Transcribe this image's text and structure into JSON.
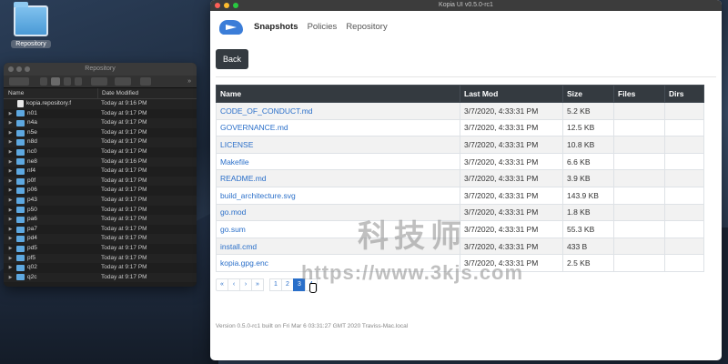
{
  "desktop": {
    "icon_label": "Repository"
  },
  "finder": {
    "title": "Repository",
    "columns": {
      "name": "Name",
      "date": "Date Modified"
    },
    "rows": [
      {
        "name": "kopia.repository.f",
        "date": "Today at 9:16 PM",
        "kind": "file"
      },
      {
        "name": "n01",
        "date": "Today at 9:17 PM",
        "kind": "folder"
      },
      {
        "name": "n4a",
        "date": "Today at 9:17 PM",
        "kind": "folder"
      },
      {
        "name": "n5e",
        "date": "Today at 9:17 PM",
        "kind": "folder"
      },
      {
        "name": "n8d",
        "date": "Today at 9:17 PM",
        "kind": "folder"
      },
      {
        "name": "nc0",
        "date": "Today at 9:17 PM",
        "kind": "folder"
      },
      {
        "name": "ne8",
        "date": "Today at 9:16 PM",
        "kind": "folder"
      },
      {
        "name": "nf4",
        "date": "Today at 9:17 PM",
        "kind": "folder"
      },
      {
        "name": "p0f",
        "date": "Today at 9:17 PM",
        "kind": "folder"
      },
      {
        "name": "p06",
        "date": "Today at 9:17 PM",
        "kind": "folder"
      },
      {
        "name": "p43",
        "date": "Today at 9:17 PM",
        "kind": "folder"
      },
      {
        "name": "p50",
        "date": "Today at 9:17 PM",
        "kind": "folder"
      },
      {
        "name": "pa6",
        "date": "Today at 9:17 PM",
        "kind": "folder"
      },
      {
        "name": "pa7",
        "date": "Today at 9:17 PM",
        "kind": "folder"
      },
      {
        "name": "pd4",
        "date": "Today at 9:17 PM",
        "kind": "folder"
      },
      {
        "name": "pd5",
        "date": "Today at 9:17 PM",
        "kind": "folder"
      },
      {
        "name": "pf5",
        "date": "Today at 9:17 PM",
        "kind": "folder"
      },
      {
        "name": "q02",
        "date": "Today at 9:17 PM",
        "kind": "folder"
      },
      {
        "name": "q2c",
        "date": "Today at 9:17 PM",
        "kind": "folder"
      }
    ]
  },
  "kopia": {
    "title": "Kopia UI v0.5.0-rc1",
    "nav": {
      "snapshots": "Snapshots",
      "policies": "Policies",
      "repository": "Repository"
    },
    "back_label": "Back",
    "table": {
      "headers": {
        "name": "Name",
        "last_mod": "Last Mod",
        "size": "Size",
        "files": "Files",
        "dirs": "Dirs"
      },
      "rows": [
        {
          "name": "CODE_OF_CONDUCT.md",
          "last_mod": "3/7/2020, 4:33:31 PM",
          "size": "5.2 KB",
          "files": "",
          "dirs": ""
        },
        {
          "name": "GOVERNANCE.md",
          "last_mod": "3/7/2020, 4:33:31 PM",
          "size": "12.5 KB",
          "files": "",
          "dirs": ""
        },
        {
          "name": "LICENSE",
          "last_mod": "3/7/2020, 4:33:31 PM",
          "size": "10.8 KB",
          "files": "",
          "dirs": ""
        },
        {
          "name": "Makefile",
          "last_mod": "3/7/2020, 4:33:31 PM",
          "size": "6.6 KB",
          "files": "",
          "dirs": ""
        },
        {
          "name": "README.md",
          "last_mod": "3/7/2020, 4:33:31 PM",
          "size": "3.9 KB",
          "files": "",
          "dirs": ""
        },
        {
          "name": "build_architecture.svg",
          "last_mod": "3/7/2020, 4:33:31 PM",
          "size": "143.9 KB",
          "files": "",
          "dirs": ""
        },
        {
          "name": "go.mod",
          "last_mod": "3/7/2020, 4:33:31 PM",
          "size": "1.8 KB",
          "files": "",
          "dirs": ""
        },
        {
          "name": "go.sum",
          "last_mod": "3/7/2020, 4:33:31 PM",
          "size": "55.3 KB",
          "files": "",
          "dirs": ""
        },
        {
          "name": "install.cmd",
          "last_mod": "3/7/2020, 4:33:31 PM",
          "size": "433 B",
          "files": "",
          "dirs": ""
        },
        {
          "name": "kopia.gpg.enc",
          "last_mod": "3/7/2020, 4:33:31 PM",
          "size": "2.5 KB",
          "files": "",
          "dirs": ""
        }
      ]
    },
    "pagination": {
      "items": [
        "«",
        "‹",
        "›",
        "»",
        "1",
        "2",
        "3",
        "4"
      ],
      "active": "3"
    },
    "footer": "Version 0.5.0-rc1 built on Fri Mar 6 03:31:27 GMT 2020 Traviss-Mac.local"
  },
  "watermark": {
    "line1": "科技师",
    "line2": "https://www.3kjs.com"
  },
  "colors": {
    "accent": "#2a6fc9",
    "dark_header": "#343a40",
    "folder": "#5ea8e0"
  }
}
